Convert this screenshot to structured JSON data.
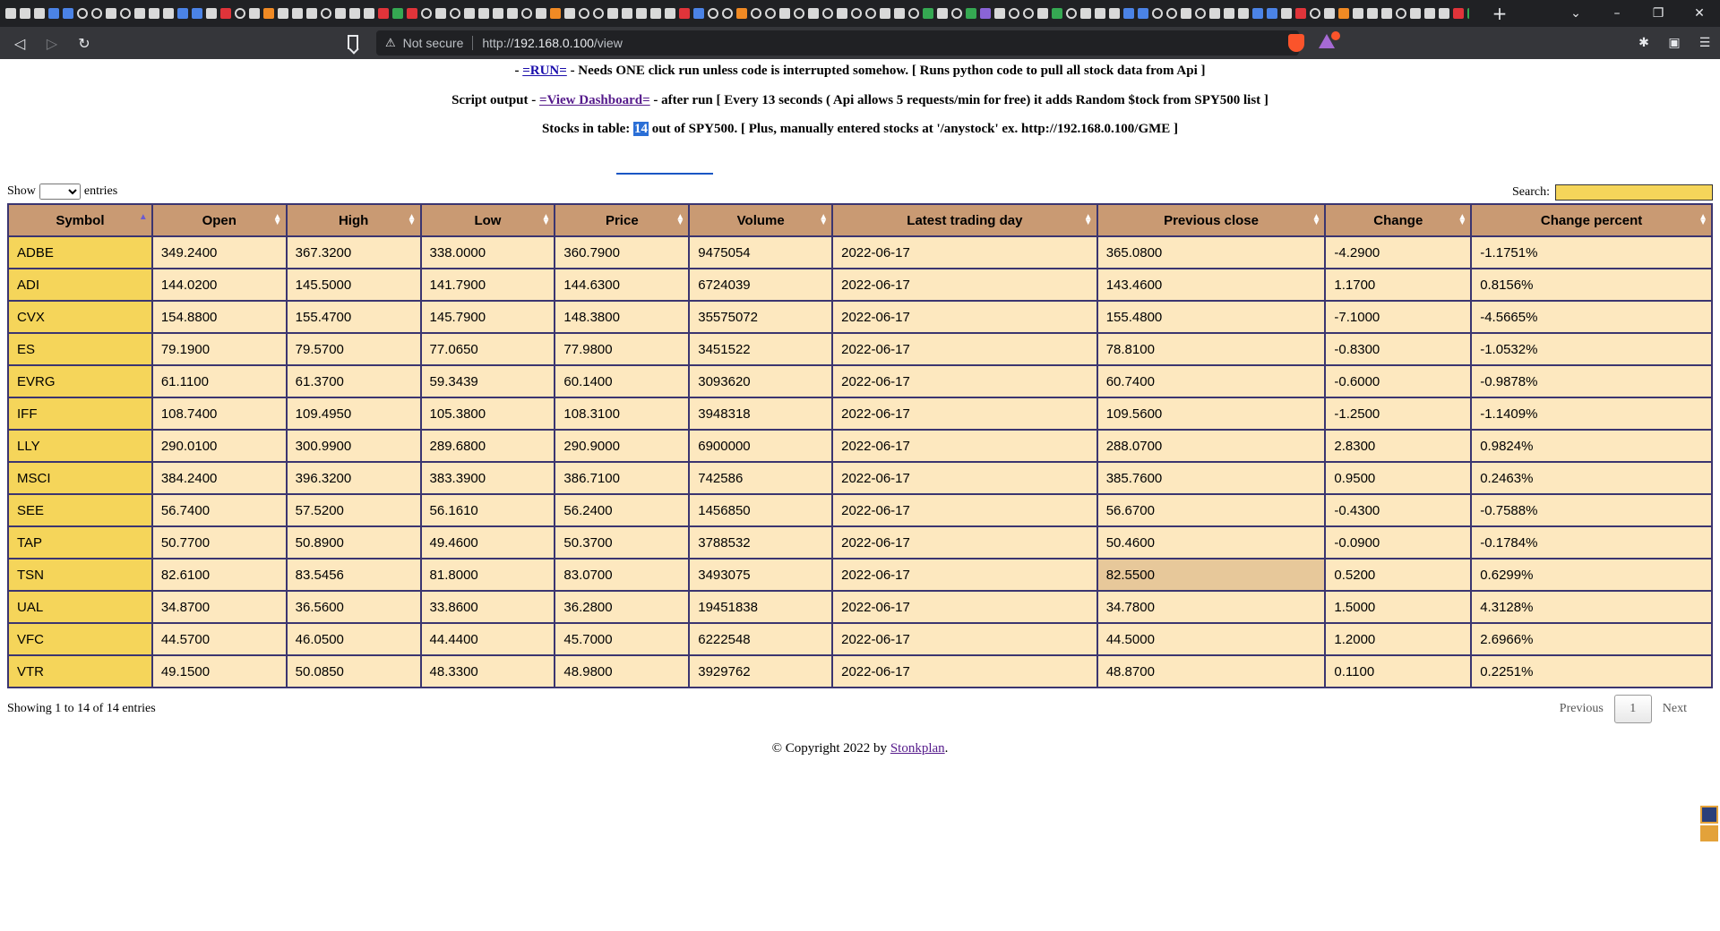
{
  "browser": {
    "security_label": "Not secure",
    "url_scheme": "http://",
    "url_host": "192.168.0.100",
    "url_path": "/view"
  },
  "page": {
    "run_prefix": "- ",
    "run_link": "=RUN=",
    "run_suffix": " - Needs ONE click run unless code is interrupted somehow. [ Runs python code to pull all stock data from Api ]",
    "script_prefix": "Script output - ",
    "dashboard_link": "=View Dashboard=",
    "script_suffix": " - after run [ Every 13 seconds ( Api allows 5 requests/min for free) it adds Random $tock from SPY500 list ]",
    "stocks_prefix": "Stocks in table: ",
    "stocks_count": "14",
    "stocks_suffix": " out of SPY500. [ Plus, manually entered stocks at '/anystock' ex. http://192.168.0.100/GME ]"
  },
  "table_controls": {
    "show_label": "Show",
    "entries_label": "entries",
    "search_label": "Search:",
    "search_value": ""
  },
  "table": {
    "columns": [
      "Symbol",
      "Open",
      "High",
      "Low",
      "Price",
      "Volume",
      "Latest trading day",
      "Previous close",
      "Change",
      "Change percent"
    ],
    "rows": [
      [
        "ADBE",
        "349.2400",
        "367.3200",
        "338.0000",
        "360.7900",
        "9475054",
        "2022-06-17",
        "365.0800",
        "-4.2900",
        "-1.1751%"
      ],
      [
        "ADI",
        "144.0200",
        "145.5000",
        "141.7900",
        "144.6300",
        "6724039",
        "2022-06-17",
        "143.4600",
        "1.1700",
        "0.8156%"
      ],
      [
        "CVX",
        "154.8800",
        "155.4700",
        "145.7900",
        "148.3800",
        "35575072",
        "2022-06-17",
        "155.4800",
        "-7.1000",
        "-4.5665%"
      ],
      [
        "ES",
        "79.1900",
        "79.5700",
        "77.0650",
        "77.9800",
        "3451522",
        "2022-06-17",
        "78.8100",
        "-0.8300",
        "-1.0532%"
      ],
      [
        "EVRG",
        "61.1100",
        "61.3700",
        "59.3439",
        "60.1400",
        "3093620",
        "2022-06-17",
        "60.7400",
        "-0.6000",
        "-0.9878%"
      ],
      [
        "IFF",
        "108.7400",
        "109.4950",
        "105.3800",
        "108.3100",
        "3948318",
        "2022-06-17",
        "109.5600",
        "-1.2500",
        "-1.1409%"
      ],
      [
        "LLY",
        "290.0100",
        "300.9900",
        "289.6800",
        "290.9000",
        "6900000",
        "2022-06-17",
        "288.0700",
        "2.8300",
        "0.9824%"
      ],
      [
        "MSCI",
        "384.2400",
        "396.3200",
        "383.3900",
        "386.7100",
        "742586",
        "2022-06-17",
        "385.7600",
        "0.9500",
        "0.2463%"
      ],
      [
        "SEE",
        "56.7400",
        "57.5200",
        "56.1610",
        "56.2400",
        "1456850",
        "2022-06-17",
        "56.6700",
        "-0.4300",
        "-0.7588%"
      ],
      [
        "TAP",
        "50.7700",
        "50.8900",
        "49.4600",
        "50.3700",
        "3788532",
        "2022-06-17",
        "50.4600",
        "-0.0900",
        "-0.1784%"
      ],
      [
        "TSN",
        "82.6100",
        "83.5456",
        "81.8000",
        "83.0700",
        "3493075",
        "2022-06-17",
        "82.5500",
        "0.5200",
        "0.6299%"
      ],
      [
        "UAL",
        "34.8700",
        "36.5600",
        "33.8600",
        "36.2800",
        "19451838",
        "2022-06-17",
        "34.7800",
        "1.5000",
        "4.3128%"
      ],
      [
        "VFC",
        "44.5700",
        "46.0500",
        "44.4400",
        "45.7000",
        "6222548",
        "2022-06-17",
        "44.5000",
        "1.2000",
        "2.6966%"
      ],
      [
        "VTR",
        "49.1500",
        "50.0850",
        "48.3300",
        "48.9800",
        "3929762",
        "2022-06-17",
        "48.8700",
        "0.1100",
        "0.2251%"
      ]
    ],
    "hover_cell": {
      "row": 10,
      "col": 7
    }
  },
  "footer": {
    "info": "Showing 1 to 14 of 14 entries",
    "prev": "Previous",
    "page": "1",
    "next": "Next",
    "copyright_prefix": "© Copyright 2022 by ",
    "copyright_link": "Stonkplan",
    "copyright_suffix": "."
  },
  "colors": {
    "header_bg": "#c99a73",
    "symbol_bg": "#f5d55a",
    "cell_bg": "#fde8bf",
    "border": "#3b3570"
  }
}
